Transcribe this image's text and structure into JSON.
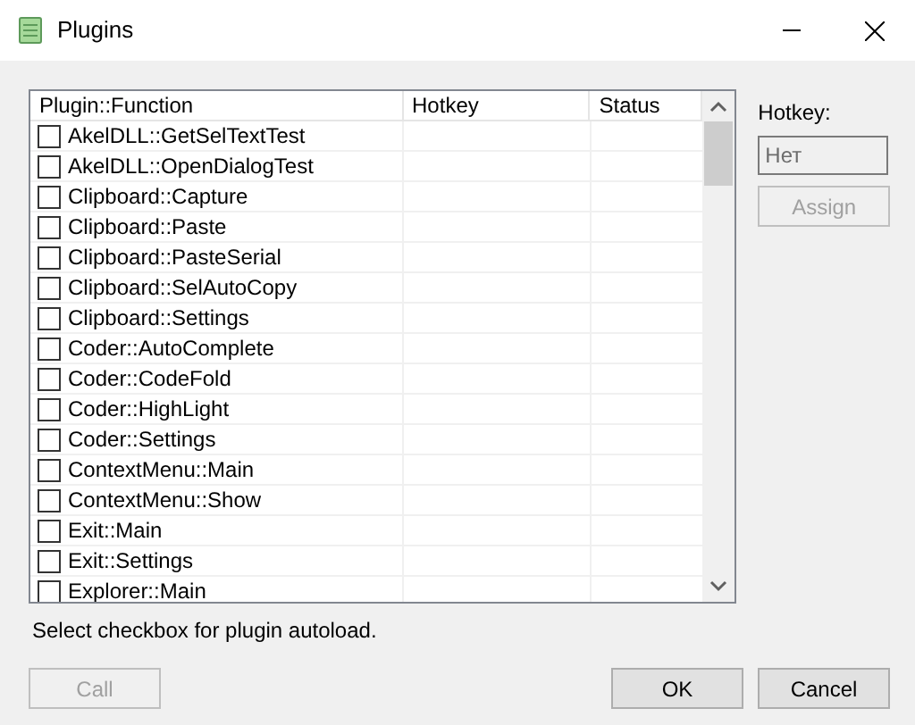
{
  "window": {
    "title": "Plugins"
  },
  "table": {
    "columns": [
      "Plugin::Function",
      "Hotkey",
      "Status"
    ],
    "rows": [
      {
        "function": "AkelDLL::GetSelTextTest",
        "checked": false
      },
      {
        "function": "AkelDLL::OpenDialogTest",
        "checked": false
      },
      {
        "function": "Clipboard::Capture",
        "checked": false
      },
      {
        "function": "Clipboard::Paste",
        "checked": false
      },
      {
        "function": "Clipboard::PasteSerial",
        "checked": false
      },
      {
        "function": "Clipboard::SelAutoCopy",
        "checked": false
      },
      {
        "function": "Clipboard::Settings",
        "checked": false
      },
      {
        "function": "Coder::AutoComplete",
        "checked": false
      },
      {
        "function": "Coder::CodeFold",
        "checked": false
      },
      {
        "function": "Coder::HighLight",
        "checked": false
      },
      {
        "function": "Coder::Settings",
        "checked": false
      },
      {
        "function": "ContextMenu::Main",
        "checked": false
      },
      {
        "function": "ContextMenu::Show",
        "checked": false
      },
      {
        "function": "Exit::Main",
        "checked": false
      },
      {
        "function": "Exit::Settings",
        "checked": false
      },
      {
        "function": "Explorer::Main",
        "checked": false
      }
    ]
  },
  "hotkey": {
    "label": "Hotkey:",
    "value": "Нет",
    "disabled": true
  },
  "assign_button": {
    "label": "Assign",
    "disabled": true
  },
  "status_text": "Select checkbox for plugin autoload.",
  "buttons": [
    {
      "label": "Call",
      "disabled": true
    },
    {
      "label": "OK",
      "disabled": false
    },
    {
      "label": "Cancel",
      "disabled": false
    }
  ]
}
